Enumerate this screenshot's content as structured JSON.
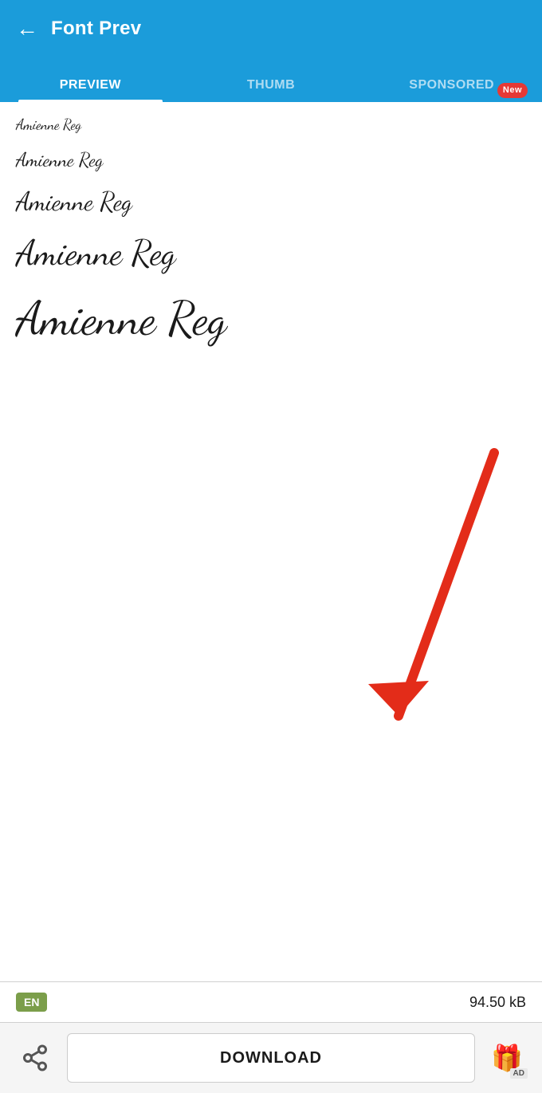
{
  "header": {
    "back_label": "←",
    "title": "Font Prev"
  },
  "tabs": [
    {
      "id": "preview",
      "label": "PREVIEW",
      "active": true,
      "badge": null
    },
    {
      "id": "thumb",
      "label": "THUMB",
      "active": false,
      "badge": null
    },
    {
      "id": "sponsored",
      "label": "SPONSORED",
      "active": false,
      "badge": "New"
    }
  ],
  "preview": {
    "font_name": "Amienne Reg",
    "samples": [
      {
        "text": "Amienne Reg",
        "size_class": "font-sample-1"
      },
      {
        "text": "Amienne Reg",
        "size_class": "font-sample-2"
      },
      {
        "text": "Amienne Reg",
        "size_class": "font-sample-3"
      },
      {
        "text": "Amienne Reg",
        "size_class": "font-sample-4"
      },
      {
        "text": "Amienne Reg",
        "size_class": "font-sample-5"
      }
    ]
  },
  "info_bar": {
    "lang": "EN",
    "file_size": "94.50 kB"
  },
  "action_bar": {
    "share_label": "share",
    "download_label": "DOWNLOAD",
    "ad_label": "AD"
  },
  "colors": {
    "header_bg": "#1b9cda",
    "active_tab_underline": "#ffffff",
    "badge_bg": "#e53935",
    "lang_badge_bg": "#7b9e4a",
    "arrow_color": "#e32c19"
  }
}
